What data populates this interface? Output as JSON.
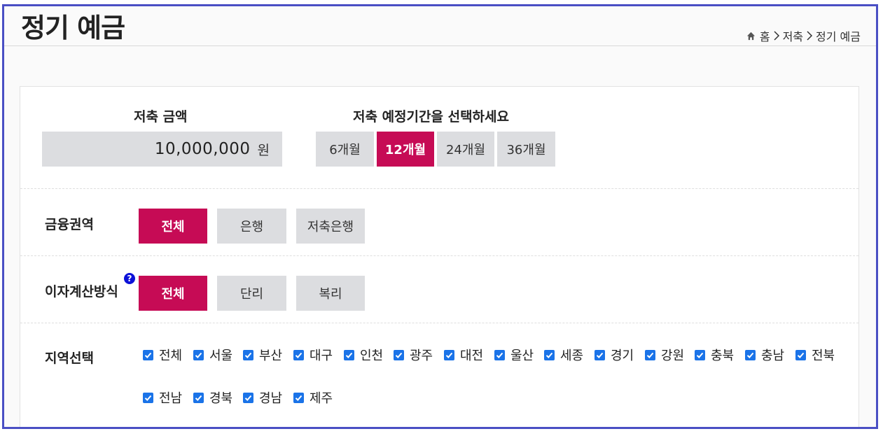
{
  "header": {
    "title": "정기 예금",
    "breadcrumb": [
      "홈",
      "저축",
      "정기 예금"
    ]
  },
  "amount": {
    "label": "저축 금액",
    "value": "10,000,000",
    "unit": "원"
  },
  "period": {
    "label": "저축 예정기간을 선택하세요",
    "options": [
      "6개월",
      "12개월",
      "24개월",
      "36개월"
    ],
    "selected": "12개월"
  },
  "finance_area": {
    "label": "금융권역",
    "options": [
      "전체",
      "은행",
      "저축은행"
    ],
    "selected": "전체"
  },
  "interest_method": {
    "label": "이자계산방식",
    "help": "?",
    "options": [
      "전체",
      "단리",
      "복리"
    ],
    "selected": "전체"
  },
  "region": {
    "label": "지역선택",
    "options": [
      "전체",
      "서울",
      "부산",
      "대구",
      "인천",
      "광주",
      "대전",
      "울산",
      "세종",
      "경기",
      "강원",
      "충북",
      "충남",
      "전북",
      "전남",
      "경북",
      "경남",
      "제주"
    ],
    "checked": [
      true,
      true,
      true,
      true,
      true,
      true,
      true,
      true,
      true,
      true,
      true,
      true,
      true,
      true,
      true,
      true,
      true,
      true
    ]
  },
  "colors": {
    "accent": "#c60b55",
    "frame": "#4a4fc4",
    "checkbox": "#1a73e8",
    "button_bg": "#dcdde0"
  }
}
